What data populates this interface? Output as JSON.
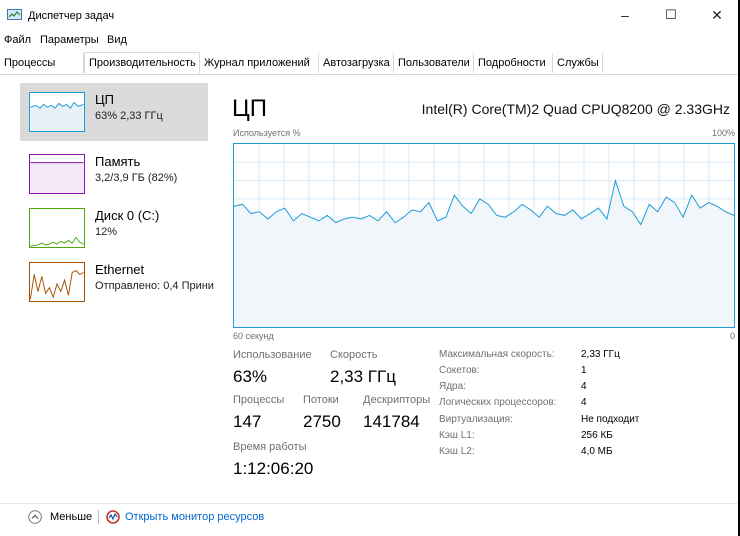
{
  "window": {
    "title": "Диспетчер задач",
    "minimize": "–",
    "maximize": "☐",
    "close": "✕"
  },
  "menu": [
    "Файл",
    "Параметры",
    "Вид"
  ],
  "tabs": [
    "Процессы",
    "Производительность",
    "Журнал приложений",
    "Автозагрузка",
    "Пользователи",
    "Подробности",
    "Службы"
  ],
  "active_tab": "Производительность",
  "sidebar": [
    {
      "title": "ЦП",
      "subtitle": "63% 2,33 ГГц",
      "color": "#1b9cd8"
    },
    {
      "title": "Память",
      "subtitle": "3,2/3,9 ГБ (82%)",
      "color": "#8b12ae"
    },
    {
      "title": "Диск 0 (C:)",
      "subtitle": "12%",
      "color": "#4da60c"
    },
    {
      "title": "Ethernet",
      "subtitle": "Отправлено: 0,4 Прини",
      "color": "#a74f01"
    }
  ],
  "main": {
    "title": "ЦП",
    "cpu_model": "Intel(R) Core(TM)2 Quad CPUQ8200 @ 2.33GHz",
    "graph_label_left": "Используется %",
    "graph_label_right": "100%",
    "time_label": "60 секунд",
    "zero_label": "0",
    "stats": {
      "usage_label": "Использование",
      "usage_value": "63%",
      "speed_label": "Скорость",
      "speed_value": "2,33 ГГц",
      "processes_label": "Процессы",
      "processes_value": "147",
      "threads_label": "Потоки",
      "threads_value": "2750",
      "handles_label": "Дескрипторы",
      "handles_value": "141784",
      "uptime_label": "Время работы",
      "uptime_value": "1:12:06:20"
    },
    "details": [
      {
        "label": "Максимальная скорость:",
        "value": "2,33 ГГц"
      },
      {
        "label": "Сокетов:",
        "value": "1"
      },
      {
        "label": "Ядра:",
        "value": "4"
      },
      {
        "label": "Логических процессоров:",
        "value": "4"
      },
      {
        "label": "Виртуализация:",
        "value": "Не подходит"
      },
      {
        "label": "Кэш L1:",
        "value": "256 КБ"
      },
      {
        "label": "Кэш L2:",
        "value": "4,0 МБ"
      }
    ],
    "cpu_history": [
      66,
      67,
      62,
      63,
      59,
      63,
      65,
      58,
      62,
      60,
      58,
      61,
      57,
      59,
      60,
      59,
      61,
      58,
      63,
      57,
      60,
      64,
      63,
      68,
      58,
      60,
      72,
      66,
      62,
      70,
      67,
      61,
      60,
      63,
      67,
      64,
      60,
      66,
      62,
      61,
      64,
      59,
      62,
      65,
      59,
      80,
      66,
      63,
      56,
      67,
      63,
      71,
      68,
      60,
      72,
      65,
      68,
      66,
      63,
      61
    ]
  },
  "footer": {
    "less_label": "Меньше",
    "monitor_link": "Открыть монитор ресурсов"
  }
}
